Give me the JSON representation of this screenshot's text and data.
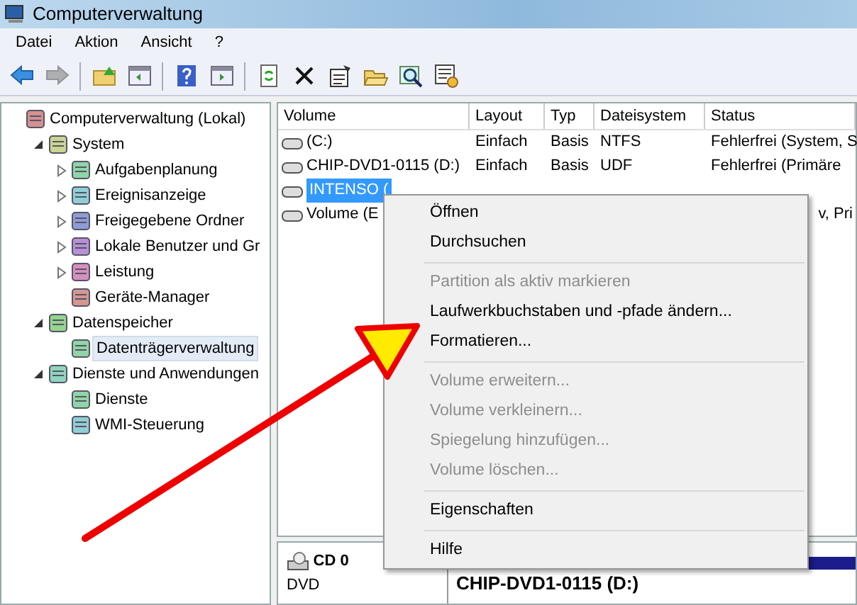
{
  "window": {
    "title": "Computerverwaltung"
  },
  "menu_bar": [
    "Datei",
    "Aktion",
    "Ansicht",
    "?"
  ],
  "toolbar": [
    {
      "kind": "back",
      "disabled": false
    },
    {
      "kind": "forward",
      "disabled": true
    },
    {
      "kind": "sep"
    },
    {
      "kind": "up",
      "disabled": false
    },
    {
      "kind": "pane",
      "disabled": false
    },
    {
      "kind": "sep"
    },
    {
      "kind": "help",
      "disabled": false
    },
    {
      "kind": "pane2",
      "disabled": false
    },
    {
      "kind": "sep"
    },
    {
      "kind": "refresh",
      "disabled": false
    },
    {
      "kind": "delete",
      "disabled": false
    },
    {
      "kind": "properties",
      "disabled": false
    },
    {
      "kind": "open",
      "disabled": false
    },
    {
      "kind": "search",
      "disabled": false
    },
    {
      "kind": "settings",
      "disabled": false
    }
  ],
  "tree": [
    {
      "label": "Computerverwaltung (Lokal)",
      "selected": false,
      "children": [
        {
          "label": "System",
          "selected": false,
          "expanded": true,
          "children": [
            {
              "label": "Aufgabenplanung",
              "selected": false,
              "expanded": false
            },
            {
              "label": "Ereignisanzeige",
              "selected": false,
              "expanded": false
            },
            {
              "label": "Freigegebene Ordner",
              "selected": false,
              "expanded": false
            },
            {
              "label": "Lokale Benutzer und Gr",
              "selected": false,
              "expanded": false
            },
            {
              "label": "Leistung",
              "selected": false,
              "expanded": false
            },
            {
              "label": "Geräte-Manager",
              "selected": false
            }
          ]
        },
        {
          "label": "Datenspeicher",
          "selected": false,
          "expanded": true,
          "children": [
            {
              "label": "Datenträgerverwaltung",
              "selected": true
            }
          ]
        },
        {
          "label": "Dienste und Anwendungen",
          "selected": false,
          "expanded": true,
          "children": [
            {
              "label": "Dienste",
              "selected": false
            },
            {
              "label": "WMI-Steuerung",
              "selected": false
            }
          ]
        }
      ]
    }
  ],
  "table": {
    "columns": [
      "Volume",
      "Layout",
      "Typ",
      "Dateisystem",
      "Status"
    ],
    "rows": [
      {
        "volume": "(C:)",
        "layout": "Einfach",
        "typ": "Basis",
        "dateisystem": "NTFS",
        "status": "Fehlerfrei (System, S",
        "selected": false
      },
      {
        "volume": "CHIP-DVD1-0115 (D:)",
        "layout": "Einfach",
        "typ": "Basis",
        "dateisystem": "UDF",
        "status": "Fehlerfrei (Primäre",
        "selected": false
      },
      {
        "volume": "INTENSO (",
        "selected": true
      },
      {
        "volume": "Volume (E",
        "status_tail": "v, Pri",
        "selected": false
      }
    ]
  },
  "context_menu": [
    {
      "kind": "item",
      "label": "Öffnen",
      "disabled": false
    },
    {
      "kind": "item",
      "label": "Durchsuchen",
      "disabled": false
    },
    {
      "kind": "separator"
    },
    {
      "kind": "item",
      "label": "Partition als aktiv markieren",
      "disabled": true
    },
    {
      "kind": "item",
      "label": "Laufwerkbuchstaben und -pfade ändern...",
      "disabled": false
    },
    {
      "kind": "item",
      "label": "Formatieren...",
      "disabled": false
    },
    {
      "kind": "separator"
    },
    {
      "kind": "item",
      "label": "Volume erweitern...",
      "disabled": true
    },
    {
      "kind": "item",
      "label": "Volume verkleinern...",
      "disabled": true
    },
    {
      "kind": "item",
      "label": "Spiegelung hinzufügen...",
      "disabled": true
    },
    {
      "kind": "item",
      "label": "Volume löschen...",
      "disabled": true
    },
    {
      "kind": "separator"
    },
    {
      "kind": "item",
      "label": "Eigenschaften",
      "disabled": false
    },
    {
      "kind": "separator"
    },
    {
      "kind": "item",
      "label": "Hilfe",
      "disabled": false
    }
  ],
  "disk_pane": {
    "disk": "CD 0",
    "type": "DVD",
    "volume": "CHIP-DVD1-0115  (D:)"
  }
}
